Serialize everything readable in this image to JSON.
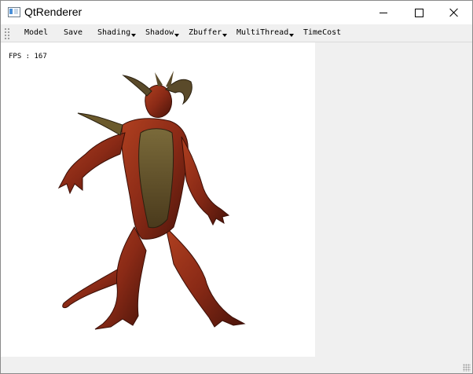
{
  "window": {
    "title": "QtRenderer",
    "icon": "app-window-icon",
    "controls": [
      "minimize-icon",
      "maximize-icon",
      "close-icon"
    ]
  },
  "toolbar": {
    "items": [
      {
        "label": "Model",
        "dropdown": false
      },
      {
        "label": "Save",
        "dropdown": false
      },
      {
        "label": "Shading",
        "dropdown": true
      },
      {
        "label": "Shadow",
        "dropdown": true
      },
      {
        "label": "Zbuffer",
        "dropdown": true
      },
      {
        "label": "MultiThread",
        "dropdown": true
      },
      {
        "label": "TimeCost",
        "dropdown": false
      }
    ]
  },
  "viewport": {
    "fps_text": "FPS : 167",
    "model_icon": "demon-model-render",
    "colors": {
      "skin": "#8a2a16",
      "armor": "#6b5a2c",
      "background": "#ffffff"
    }
  }
}
